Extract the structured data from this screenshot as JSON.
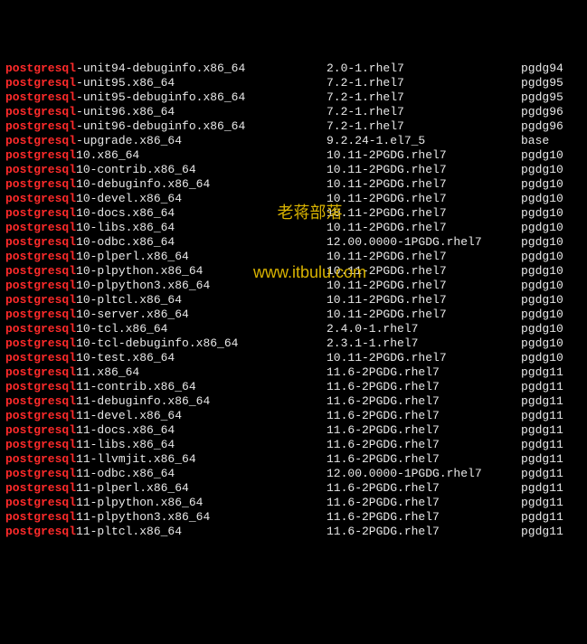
{
  "highlight_term": "postgresql",
  "watermark": {
    "line1": "老蒋部落",
    "line2": "www.itbulu.com"
  },
  "rows": [
    {
      "prefix": "postgresql",
      "suffix": "-unit94-debuginfo.x86_64",
      "version": "2.0-1.rhel7",
      "repo": "pgdg94"
    },
    {
      "prefix": "postgresql",
      "suffix": "-unit95.x86_64",
      "version": "7.2-1.rhel7",
      "repo": "pgdg95"
    },
    {
      "prefix": "postgresql",
      "suffix": "-unit95-debuginfo.x86_64",
      "version": "7.2-1.rhel7",
      "repo": "pgdg95"
    },
    {
      "prefix": "postgresql",
      "suffix": "-unit96.x86_64",
      "version": "7.2-1.rhel7",
      "repo": "pgdg96"
    },
    {
      "prefix": "postgresql",
      "suffix": "-unit96-debuginfo.x86_64",
      "version": "7.2-1.rhel7",
      "repo": "pgdg96"
    },
    {
      "prefix": "postgresql",
      "suffix": "-upgrade.x86_64",
      "version": "9.2.24-1.el7_5",
      "repo": "base"
    },
    {
      "prefix": "postgresql",
      "suffix": "10.x86_64",
      "version": "10.11-2PGDG.rhel7",
      "repo": "pgdg10"
    },
    {
      "prefix": "postgresql",
      "suffix": "10-contrib.x86_64",
      "version": "10.11-2PGDG.rhel7",
      "repo": "pgdg10"
    },
    {
      "prefix": "postgresql",
      "suffix": "10-debuginfo.x86_64",
      "version": "10.11-2PGDG.rhel7",
      "repo": "pgdg10"
    },
    {
      "prefix": "postgresql",
      "suffix": "10-devel.x86_64",
      "version": "10.11-2PGDG.rhel7",
      "repo": "pgdg10"
    },
    {
      "prefix": "postgresql",
      "suffix": "10-docs.x86_64",
      "version": "10.11-2PGDG.rhel7",
      "repo": "pgdg10"
    },
    {
      "prefix": "postgresql",
      "suffix": "10-libs.x86_64",
      "version": "10.11-2PGDG.rhel7",
      "repo": "pgdg10"
    },
    {
      "prefix": "postgresql",
      "suffix": "10-odbc.x86_64",
      "version": "12.00.0000-1PGDG.rhel7",
      "repo": "pgdg10"
    },
    {
      "prefix": "postgresql",
      "suffix": "10-plperl.x86_64",
      "version": "10.11-2PGDG.rhel7",
      "repo": "pgdg10"
    },
    {
      "prefix": "postgresql",
      "suffix": "10-plpython.x86_64",
      "version": "10.11-2PGDG.rhel7",
      "repo": "pgdg10"
    },
    {
      "prefix": "postgresql",
      "suffix": "10-plpython3.x86_64",
      "version": "10.11-2PGDG.rhel7",
      "repo": "pgdg10"
    },
    {
      "prefix": "postgresql",
      "suffix": "10-pltcl.x86_64",
      "version": "10.11-2PGDG.rhel7",
      "repo": "pgdg10"
    },
    {
      "prefix": "postgresql",
      "suffix": "10-server.x86_64",
      "version": "10.11-2PGDG.rhel7",
      "repo": "pgdg10"
    },
    {
      "prefix": "postgresql",
      "suffix": "10-tcl.x86_64",
      "version": "2.4.0-1.rhel7",
      "repo": "pgdg10"
    },
    {
      "prefix": "postgresql",
      "suffix": "10-tcl-debuginfo.x86_64",
      "version": "2.3.1-1.rhel7",
      "repo": "pgdg10"
    },
    {
      "prefix": "postgresql",
      "suffix": "10-test.x86_64",
      "version": "10.11-2PGDG.rhel7",
      "repo": "pgdg10"
    },
    {
      "prefix": "postgresql",
      "suffix": "11.x86_64",
      "version": "11.6-2PGDG.rhel7",
      "repo": "pgdg11"
    },
    {
      "prefix": "postgresql",
      "suffix": "11-contrib.x86_64",
      "version": "11.6-2PGDG.rhel7",
      "repo": "pgdg11"
    },
    {
      "prefix": "postgresql",
      "suffix": "11-debuginfo.x86_64",
      "version": "11.6-2PGDG.rhel7",
      "repo": "pgdg11"
    },
    {
      "prefix": "postgresql",
      "suffix": "11-devel.x86_64",
      "version": "11.6-2PGDG.rhel7",
      "repo": "pgdg11"
    },
    {
      "prefix": "postgresql",
      "suffix": "11-docs.x86_64",
      "version": "11.6-2PGDG.rhel7",
      "repo": "pgdg11"
    },
    {
      "prefix": "postgresql",
      "suffix": "11-libs.x86_64",
      "version": "11.6-2PGDG.rhel7",
      "repo": "pgdg11"
    },
    {
      "prefix": "postgresql",
      "suffix": "11-llvmjit.x86_64",
      "version": "11.6-2PGDG.rhel7",
      "repo": "pgdg11"
    },
    {
      "prefix": "postgresql",
      "suffix": "11-odbc.x86_64",
      "version": "12.00.0000-1PGDG.rhel7",
      "repo": "pgdg11"
    },
    {
      "prefix": "postgresql",
      "suffix": "11-plperl.x86_64",
      "version": "11.6-2PGDG.rhel7",
      "repo": "pgdg11"
    },
    {
      "prefix": "postgresql",
      "suffix": "11-plpython.x86_64",
      "version": "11.6-2PGDG.rhel7",
      "repo": "pgdg11"
    },
    {
      "prefix": "postgresql",
      "suffix": "11-plpython3.x86_64",
      "version": "11.6-2PGDG.rhel7",
      "repo": "pgdg11"
    },
    {
      "prefix": "postgresql",
      "suffix": "11-pltcl.x86_64",
      "version": "11.6-2PGDG.rhel7",
      "repo": "pgdg11"
    }
  ]
}
